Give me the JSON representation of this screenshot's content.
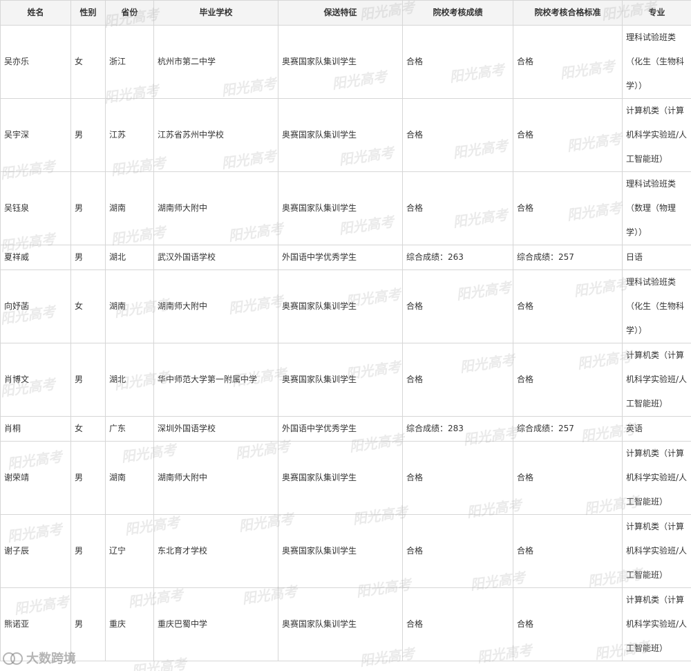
{
  "headers": [
    "姓名",
    "性别",
    "省份",
    "毕业学校",
    "保送特征",
    "院校考核成绩",
    "院校考核合格标准",
    "专业"
  ],
  "rows": [
    {
      "name": "吴亦乐",
      "gender": "女",
      "province": "浙江",
      "school": "杭州市第二中学",
      "feature": "奥赛国家队集训学生",
      "score": "合格",
      "standard": "合格",
      "major": "理科试验班类（化生（生物科学））",
      "size": "tall"
    },
    {
      "name": "吴宇深",
      "gender": "男",
      "province": "江苏",
      "school": "江苏省苏州中学校",
      "feature": "奥赛国家队集训学生",
      "score": "合格",
      "standard": "合格",
      "major": "计算机类（计算机科学实验班/人工智能班）",
      "size": "tall"
    },
    {
      "name": "吴钰泉",
      "gender": "男",
      "province": "湖南",
      "school": "湖南师大附中",
      "feature": "奥赛国家队集训学生",
      "score": "合格",
      "standard": "合格",
      "major": "理科试验班类（数理（物理学））",
      "size": "tall"
    },
    {
      "name": "夏祥威",
      "gender": "男",
      "province": "湖北",
      "school": "武汉外国语学校",
      "feature": "外国语中学优秀学生",
      "score": "综合成绩：263",
      "standard": "综合成绩：257",
      "major": "日语",
      "size": "short"
    },
    {
      "name": "向妤菡",
      "gender": "女",
      "province": "湖南",
      "school": "湖南师大附中",
      "feature": "奥赛国家队集训学生",
      "score": "合格",
      "standard": "合格",
      "major": "理科试验班类（化生（生物科学））",
      "size": "tall"
    },
    {
      "name": "肖博文",
      "gender": "男",
      "province": "湖北",
      "school": "华中师范大学第一附属中学",
      "feature": "奥赛国家队集训学生",
      "score": "合格",
      "standard": "合格",
      "major": "计算机类（计算机科学实验班/人工智能班）",
      "size": "tall"
    },
    {
      "name": "肖桐",
      "gender": "女",
      "province": "广东",
      "school": "深圳外国语学校",
      "feature": "外国语中学优秀学生",
      "score": "综合成绩：283",
      "standard": "综合成绩：257",
      "major": "英语",
      "size": "short"
    },
    {
      "name": "谢荣靖",
      "gender": "男",
      "province": "湖南",
      "school": "湖南师大附中",
      "feature": "奥赛国家队集训学生",
      "score": "合格",
      "standard": "合格",
      "major": "计算机类（计算机科学实验班/人工智能班）",
      "size": "tall"
    },
    {
      "name": "谢子辰",
      "gender": "男",
      "province": "辽宁",
      "school": "东北育才学校",
      "feature": "奥赛国家队集训学生",
      "score": "合格",
      "standard": "合格",
      "major": "计算机类（计算机科学实验班/人工智能班）",
      "size": "tall"
    },
    {
      "name": "熊诺亚",
      "gender": "男",
      "province": "重庆",
      "school": "重庆巴蜀中学",
      "feature": "奥赛国家队集训学生",
      "score": "合格",
      "standard": "合格",
      "major": "计算机类（计算机科学实验班/人工智能班）",
      "size": "tall"
    }
  ],
  "watermark_text": "阳光高考",
  "logo_text": "大数跨境"
}
